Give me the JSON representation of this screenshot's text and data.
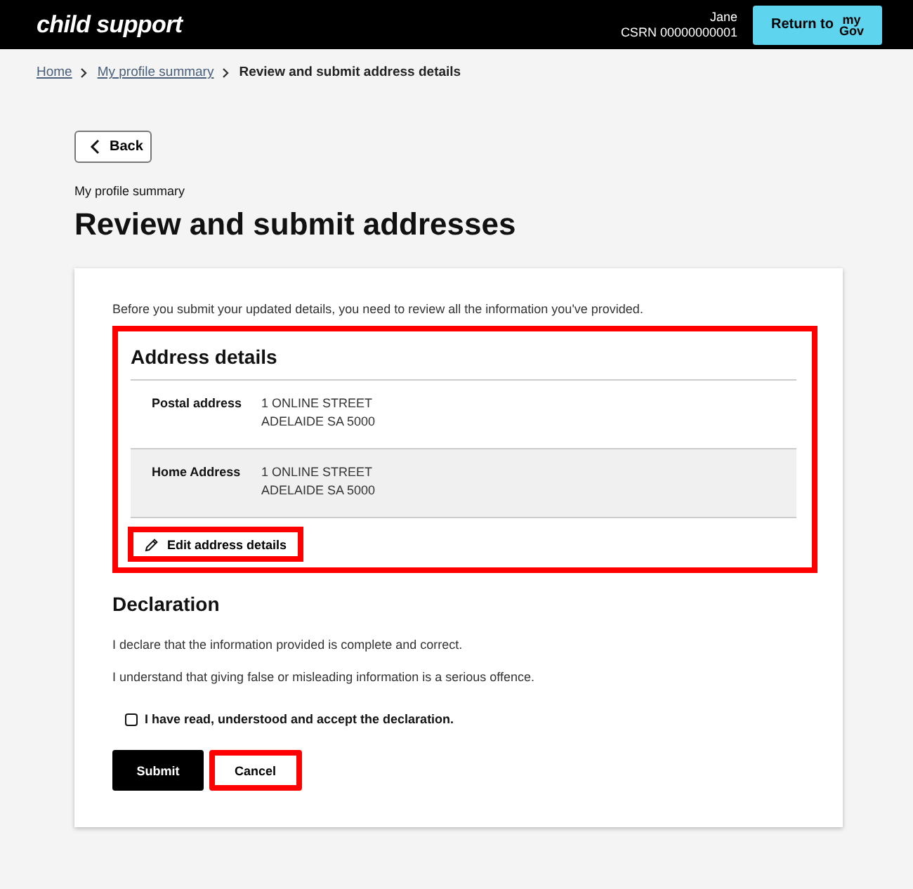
{
  "header": {
    "logo": "child support",
    "user_name": "Jane",
    "csrn": "CSRN 00000000001",
    "return_button": {
      "label": "Return to",
      "brand_top": "my",
      "brand_bottom": "Gov"
    }
  },
  "breadcrumbs": [
    {
      "label": "Home",
      "kind": "link"
    },
    {
      "label": "My profile summary",
      "kind": "link"
    },
    {
      "label": "Review and submit address details",
      "kind": "current"
    }
  ],
  "back_button": "Back",
  "eyebrow": "My profile summary",
  "title": "Review and submit addresses",
  "intro": "Before you submit your updated details, you need to review all the information you've provided.",
  "address_section": {
    "heading": "Address details",
    "highlighted": true,
    "rows": [
      {
        "label": "Postal address",
        "lines": [
          "1 ONLINE STREET",
          "ADELAIDE SA 5000"
        ],
        "shaded": false
      },
      {
        "label": "Home Address",
        "lines": [
          "1 ONLINE STREET",
          "ADELAIDE SA 5000"
        ],
        "shaded": true
      }
    ],
    "edit_button": {
      "label": "Edit address details",
      "highlighted": true
    }
  },
  "declaration": {
    "heading": "Declaration",
    "paragraphs": [
      "I declare that the information provided is complete and correct.",
      "I understand that giving false or misleading information is a serious offence."
    ],
    "checkbox": {
      "label": "I have read, understood and accept the declaration.",
      "checked": false
    }
  },
  "buttons": [
    {
      "label": "Submit",
      "kind": "primary",
      "highlighted": false
    },
    {
      "label": "Cancel",
      "kind": "secondary",
      "highlighted": true
    }
  ]
}
